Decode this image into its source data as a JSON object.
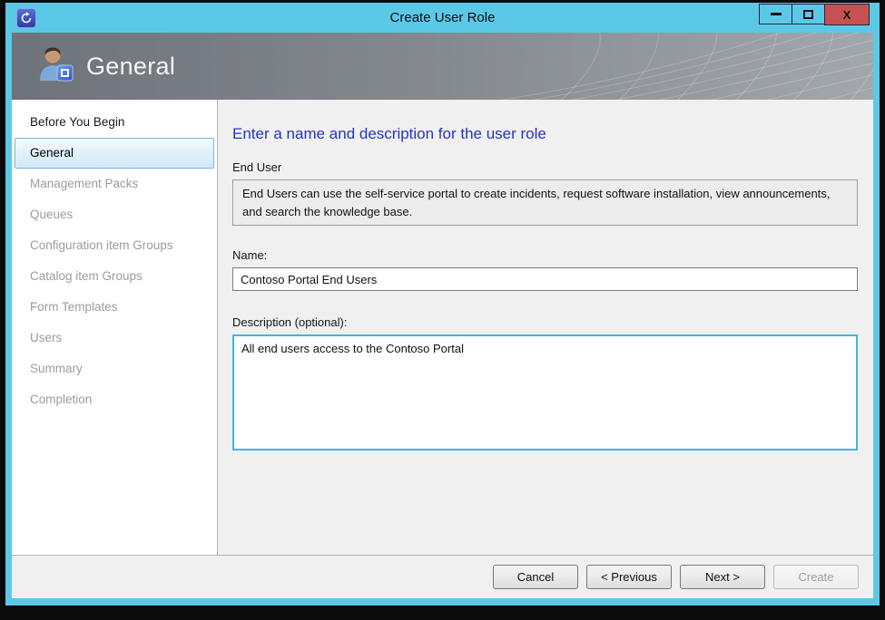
{
  "window": {
    "title": "Create User Role",
    "controls": {
      "close_glyph": "X"
    }
  },
  "header": {
    "title": "General"
  },
  "sidebar": {
    "items": [
      {
        "label": "Before You Begin",
        "state": "done"
      },
      {
        "label": "General",
        "state": "active"
      },
      {
        "label": "Management Packs",
        "state": "disabled"
      },
      {
        "label": "Queues",
        "state": "disabled"
      },
      {
        "label": "Configuration item Groups",
        "state": "disabled"
      },
      {
        "label": "Catalog item Groups",
        "state": "disabled"
      },
      {
        "label": "Form Templates",
        "state": "disabled"
      },
      {
        "label": "Users",
        "state": "disabled"
      },
      {
        "label": "Summary",
        "state": "disabled"
      },
      {
        "label": "Completion",
        "state": "disabled"
      }
    ]
  },
  "content": {
    "heading": "Enter a name and description for the user role",
    "profile_label": "End User",
    "profile_description": "End Users can use the self-service portal to create incidents, request software installation, view announcements, and search the knowledge base.",
    "name_label": "Name:",
    "name_value": "Contoso Portal End Users",
    "description_label": "Description (optional):",
    "description_value": "All end users access to the Contoso Portal"
  },
  "footer": {
    "buttons": [
      {
        "label": "Cancel",
        "enabled": true
      },
      {
        "label": "< Previous",
        "enabled": true
      },
      {
        "label": "Next >",
        "enabled": true
      },
      {
        "label": "Create",
        "enabled": false
      }
    ]
  },
  "colors": {
    "frame_accent": "#5CC8E8",
    "close_button": "#C75050",
    "heading_blue": "#2733BE",
    "selection_border": "#7EB4D8",
    "banner_gray": "#6E737A"
  }
}
